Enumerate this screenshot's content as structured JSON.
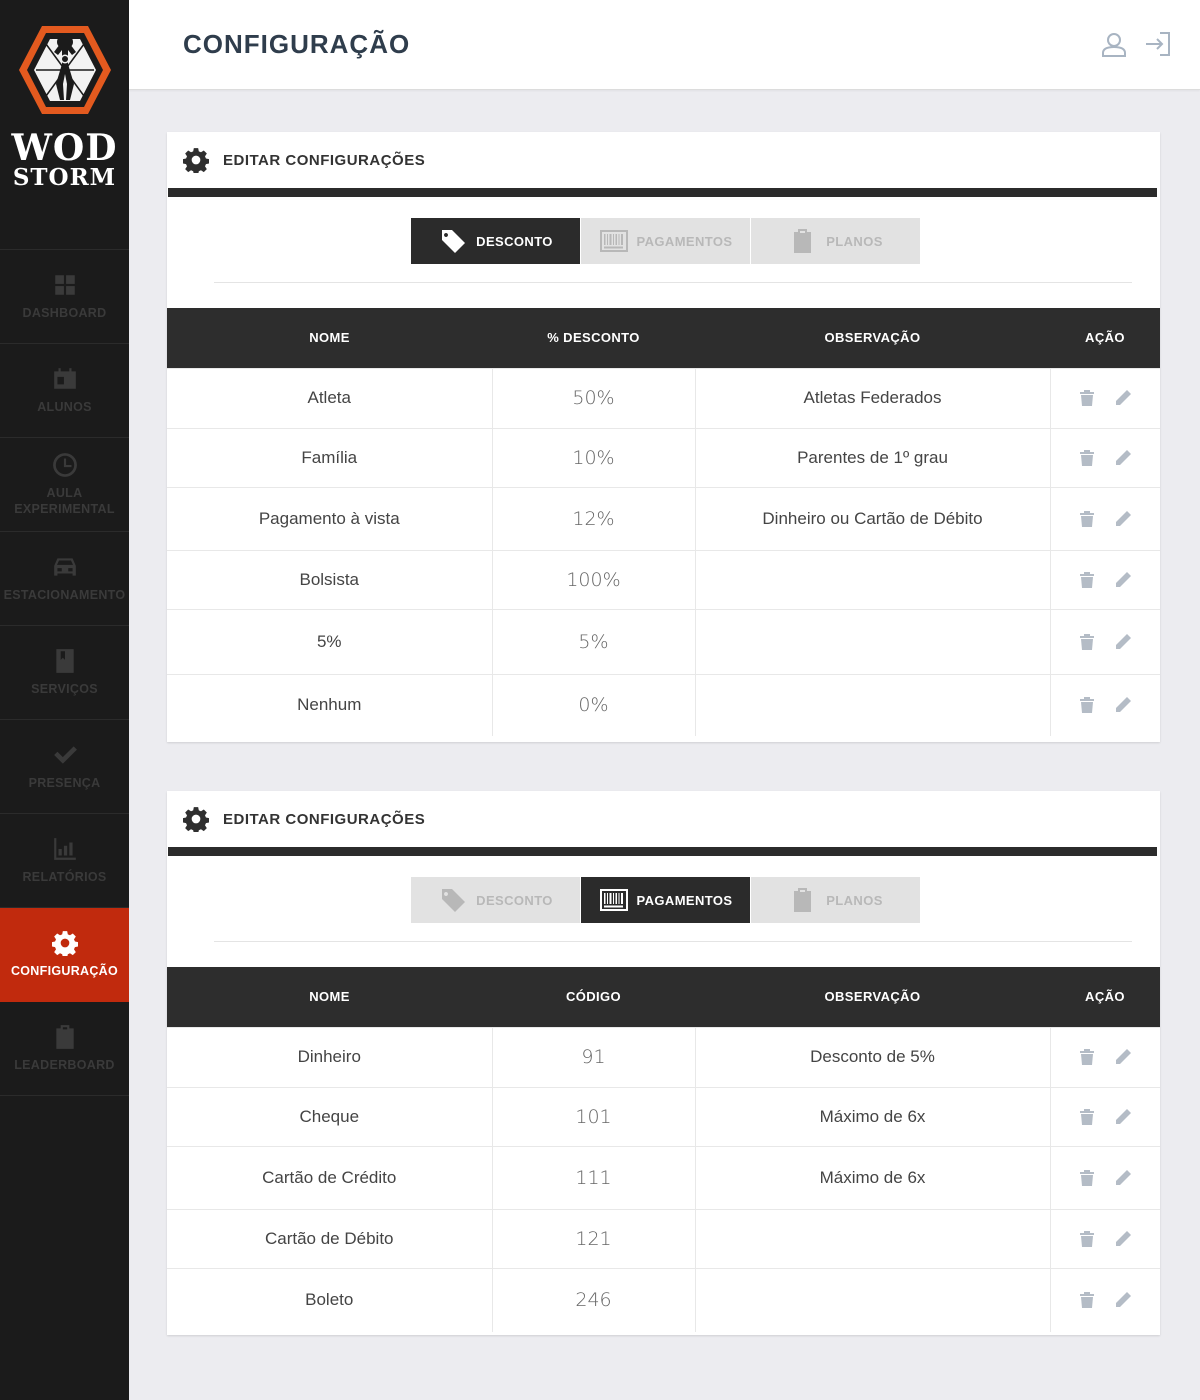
{
  "brand": {
    "line1": "WOD",
    "line2": "STORM"
  },
  "sidebar": {
    "items": [
      {
        "label": "DASHBOARD",
        "icon": "grid-icon",
        "active": false
      },
      {
        "label": "ALUNOS",
        "icon": "id-card-icon",
        "active": false
      },
      {
        "label": "AULA EXPERIMENTAL",
        "icon": "clock-icon",
        "active": false
      },
      {
        "label": "ESTACIONAMENTO",
        "icon": "car-icon",
        "active": false
      },
      {
        "label": "SERVIÇOS",
        "icon": "book-icon",
        "active": false
      },
      {
        "label": "PRESENÇA",
        "icon": "check-icon",
        "active": false
      },
      {
        "label": "RELATÓRIOS",
        "icon": "chart-icon",
        "active": false
      },
      {
        "label": "CONFIGURAÇÃO",
        "icon": "gear-icon",
        "active": true
      },
      {
        "label": "LEADERBOARD",
        "icon": "clipboard-icon",
        "active": false
      }
    ]
  },
  "header": {
    "title": "CONFIGURAÇÃO"
  },
  "tabs": {
    "discount": "DESCONTO",
    "payments": "PAGAMENTOS",
    "plans": "PLANOS"
  },
  "discount_card": {
    "title": "EDITAR CONFIGURAÇÕES",
    "headers": [
      "NOME",
      "% DESCONTO",
      "OBSERVAÇÃO",
      "AÇÃO"
    ],
    "rows": [
      [
        "Atleta",
        "50%",
        "Atletas Federados"
      ],
      [
        "Família",
        "10%",
        "Parentes de 1º grau"
      ],
      [
        "Pagamento à vista",
        "12%",
        "Dinheiro ou Cartão de Débito"
      ],
      [
        "Bolsista",
        "100%",
        ""
      ],
      [
        "5%",
        "5%",
        ""
      ],
      [
        "Nenhum",
        "0%",
        ""
      ]
    ]
  },
  "payment_card": {
    "title": "EDITAR CONFIGURAÇÕES",
    "headers": [
      "NOME",
      "CÓDIGO",
      "OBSERVAÇÃO",
      "AÇÃO"
    ],
    "rows": [
      [
        "Dinheiro",
        "91",
        "Desconto de 5%"
      ],
      [
        "Cheque",
        "101",
        "Máximo de 6x"
      ],
      [
        "Cartão de Crédito",
        "111",
        "Máximo de 6x"
      ],
      [
        "Cartão de Débito",
        "121",
        ""
      ],
      [
        "Boleto",
        "246",
        ""
      ]
    ]
  },
  "colors": {
    "sidebar_bg": "#1b1b1b",
    "active_accent": "#c12a0d",
    "dark_bar": "#2b2b2b",
    "page_bg": "#ececf0"
  }
}
